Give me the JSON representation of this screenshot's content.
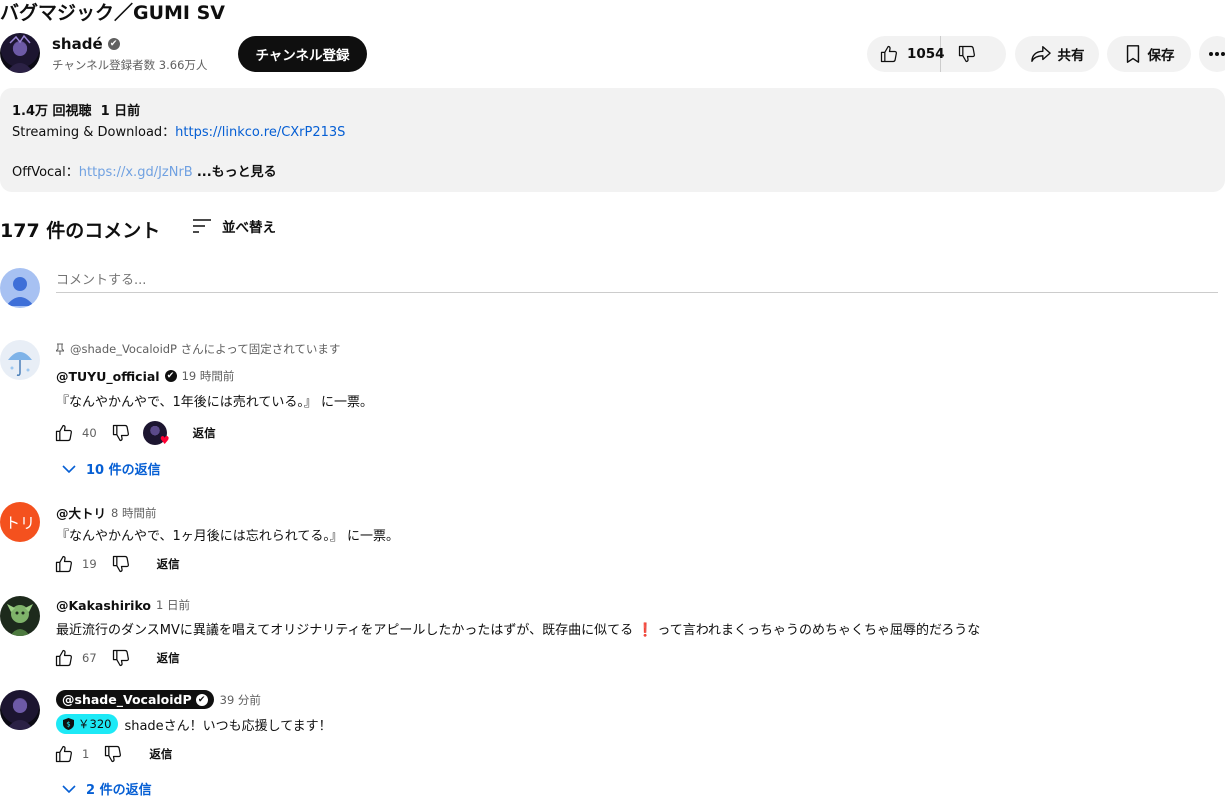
{
  "video": {
    "title": "バグマジック／GUMI SV"
  },
  "channel": {
    "name": "shadé",
    "verified_icon": "✔",
    "subscribers": "チャンネル登録者数 3.66万人",
    "subscribe_label": "チャンネル登録"
  },
  "actions": {
    "like_count": "1054",
    "share_label": "共有",
    "save_label": "保存"
  },
  "description": {
    "meta": "1.4万 回視聴  1 日前",
    "line1_prefix": "Streaming & Download：",
    "line1_link": "https://linkco.re/CXrP213S",
    "line2_prefix": "OffVocal：",
    "line2_link": "https://x.gd/JzNrB",
    "more_label": "...もっと見る"
  },
  "comments_header": {
    "count_label": "177 件のコメント",
    "sort_label": "並べ替え",
    "input_placeholder": "コメントする..."
  },
  "comments": [
    {
      "pinned_text": "@shade_VocaloidP さんによって固定されています",
      "author": "@TUYU_official",
      "time": "19 時間前",
      "text": "『なんやかんやで、1年後には売れている。』 に一票。",
      "likes": "40",
      "reply_label": "返信",
      "replies_label": "10 件の返信"
    },
    {
      "author": "@大トリ",
      "avatar_text": "トリ",
      "time": "8 時間前",
      "text": "『なんやかんやで、1ヶ月後には忘れられてる。』 に一票。",
      "likes": "19",
      "reply_label": "返信"
    },
    {
      "author": "@Kakashiriko",
      "time": "1 日前",
      "text_part1": "最近流行のダンスMVに異議を唱えてオリジナリティをアピールしたかったはずが、既存曲に似てる",
      "text_part2": "って言われまくっちゃうのめちゃくちゃ屈辱的だろうな",
      "likes": "67",
      "reply_label": "返信"
    },
    {
      "author": "@shade_VocaloidP",
      "time": "39 分前",
      "superchat_amount": "￥320",
      "text": "shadeさん！いつも応援してます！",
      "likes": "1",
      "reply_label": "返信",
      "replies_label": "2 件の返信"
    }
  ],
  "colors": {
    "link": "#065fd4",
    "superchat": "#1de9f6",
    "avatar_tori": "#f4511e"
  }
}
